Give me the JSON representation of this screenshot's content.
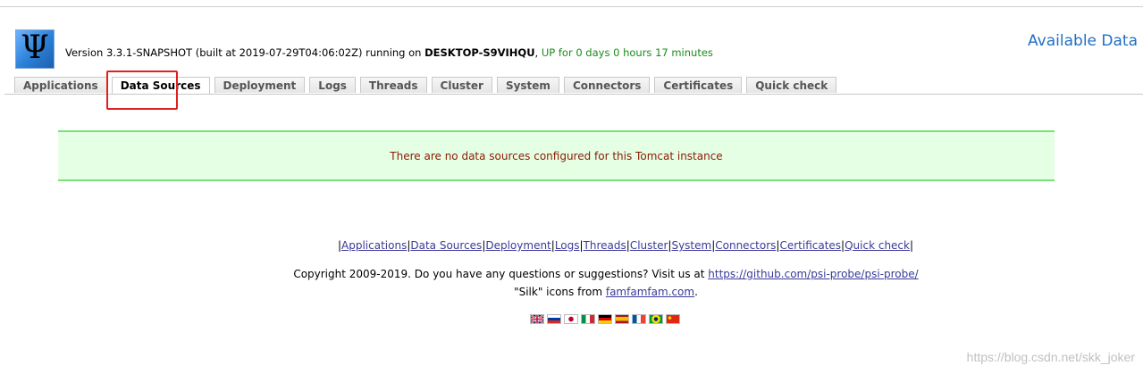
{
  "header": {
    "logo_glyph": "Ψ",
    "version_prefix": "Version 3.3.1-SNAPSHOT (built at 2019-07-29T04:06:02Z) running on ",
    "host": "DESKTOP-S9VIHQU",
    "uptime": "UP for 0 days 0 hours 17 minutes",
    "page_heading": "Available Data"
  },
  "tabs": [
    {
      "label": "Applications",
      "active": false
    },
    {
      "label": "Data Sources",
      "active": true
    },
    {
      "label": "Deployment",
      "active": false
    },
    {
      "label": "Logs",
      "active": false
    },
    {
      "label": "Threads",
      "active": false
    },
    {
      "label": "Cluster",
      "active": false
    },
    {
      "label": "System",
      "active": false
    },
    {
      "label": "Connectors",
      "active": false
    },
    {
      "label": "Certificates",
      "active": false
    },
    {
      "label": "Quick check",
      "active": false
    }
  ],
  "message": {
    "text": "There are no data sources configured for this Tomcat instance"
  },
  "footer": {
    "links": [
      "Applications",
      "Data Sources",
      "Deployment",
      "Logs",
      "Threads",
      "Cluster",
      "System",
      "Connectors",
      "Certificates",
      "Quick check"
    ],
    "copyright_text": "Copyright 2009-2019. Do you have any questions or suggestions? Visit us at ",
    "repo_link": "https://github.com/psi-probe/psi-probe/",
    "silk_text": "\"Silk\" icons from ",
    "silk_link": "famfamfam.com",
    "silk_suffix": "."
  },
  "flags": [
    "gb-flag-icon",
    "ru-flag-icon",
    "jp-flag-icon",
    "it-flag-icon",
    "de-flag-icon",
    "es-flag-icon",
    "fr-flag-icon",
    "br-flag-icon",
    "cn-flag-icon"
  ],
  "colors": {
    "accent": "#1f6fc6",
    "uptime": "#1a8a1a",
    "message_bg": "#e5ffe5",
    "message_border": "#7ae27a",
    "message_text": "#8b1a00",
    "highlight": "#e02020"
  },
  "watermark": "https://blog.csdn.net/skk_joker"
}
